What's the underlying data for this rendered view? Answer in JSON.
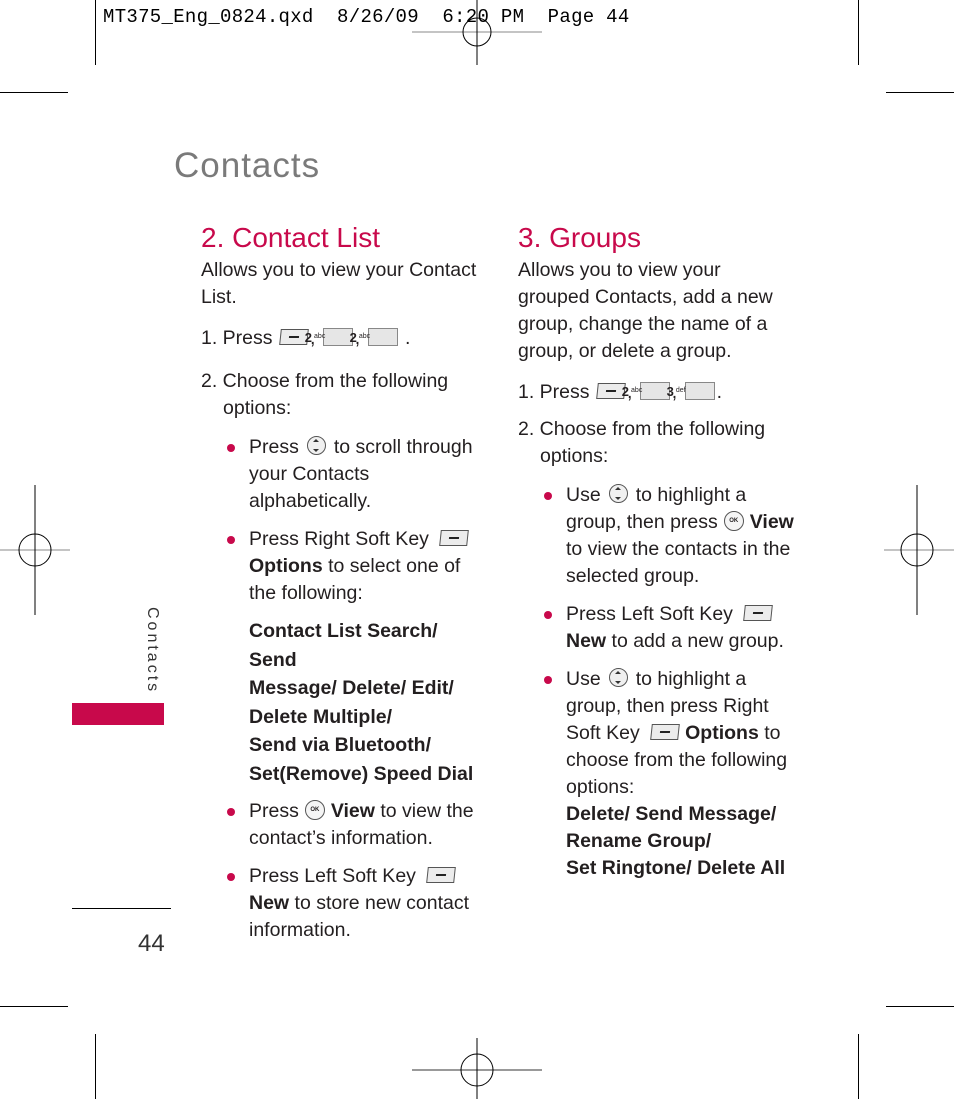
{
  "slug": {
    "text": "MT375_Eng_0824.qxd  8/26/09  6:20 PM  Page 44"
  },
  "page_title": "Contacts",
  "side_tab_label": "Contacts",
  "page_number": "44",
  "section_contact_list": {
    "heading": "2. Contact List",
    "intro": "Allows you to view your Contact List.",
    "step1": {
      "prefix": "1. Press",
      "keys": [
        {
          "icon": "left-soft-key-icon"
        },
        {
          "icon": "key-2-icon",
          "digit": "2",
          "letters": "abc"
        },
        {
          "icon": "key-2-icon",
          "digit": "2",
          "letters": "abc"
        }
      ]
    },
    "step2": "2. Choose from the following options:",
    "bullets": [
      {
        "pre": "Press",
        "icon": "nav-key-icon",
        "post": "to scroll through your Contacts alphabetically."
      },
      {
        "pre": "Press Right Soft Key",
        "icon": "right-soft-key-icon",
        "bold": "Options",
        "post": " to select one of the following:"
      },
      {
        "pre": "Press",
        "icon": "ok-key-icon",
        "bold": "View",
        "post": " to view the contact’s information."
      },
      {
        "pre": "Press Left Soft Key",
        "icon": "left-soft-key-icon",
        "bold": "New",
        "post": " to store new contact information."
      }
    ],
    "options_lines": [
      "Contact List Search/ Send",
      "Message/ Delete/ Edit/",
      "Delete Multiple/",
      "Send via Bluetooth/",
      "Set(Remove) Speed Dial"
    ]
  },
  "section_groups": {
    "heading": "3. Groups",
    "intro": "Allows you to view your grouped Contacts, add a new group, change the name of a group, or delete a group.",
    "step1": {
      "prefix": "1. Press",
      "keys": [
        {
          "icon": "left-soft-key-icon"
        },
        {
          "icon": "key-2-icon",
          "digit": "2",
          "letters": "abc"
        },
        {
          "icon": "key-3-icon",
          "digit": "3",
          "letters": "def"
        }
      ]
    },
    "step2": "2. Choose from the following options:",
    "bullets": [
      {
        "pre": "Use",
        "icon": "nav-key-icon",
        "mid": "to highlight a group, then press",
        "icon2": "ok-key-icon",
        "bold": "View",
        "post": " to view the contacts in the selected group."
      },
      {
        "pre": "Press Left Soft Key",
        "icon": "left-soft-key-icon",
        "bold": "New",
        "post": " to add a new group."
      },
      {
        "pre": "Use",
        "icon": "nav-key-icon",
        "mid": "to highlight a group, then press Right Soft Key",
        "icon2": "right-soft-key-icon",
        "bold": "Options",
        "post": " to choose from the following options:"
      }
    ],
    "options_lines": [
      "Delete/ Send Message/",
      "Rename Group/",
      "Set Ringtone/ Delete All"
    ]
  },
  "colors": {
    "accent": "#c8094b",
    "title_gray": "#7a7a7a",
    "body_text": "#231f20"
  }
}
